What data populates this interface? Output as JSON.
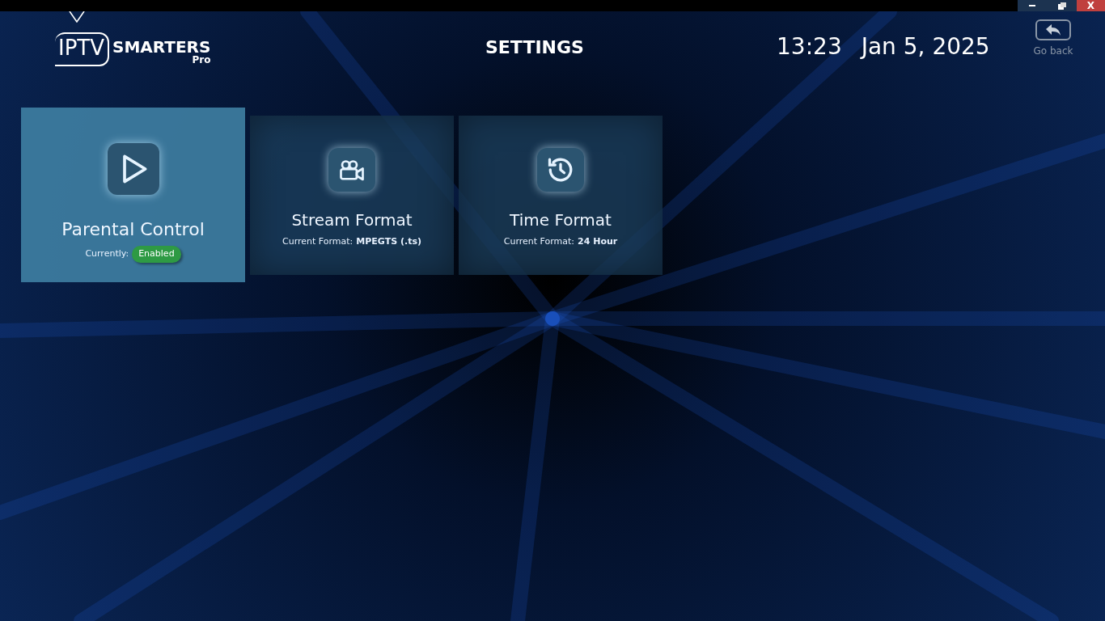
{
  "window_controls": {
    "close": "X"
  },
  "logo": {
    "word_1": "IPTV",
    "word_2": "SMARTERS",
    "subtitle": "Pro"
  },
  "header": {
    "title": "SETTINGS",
    "time": "13:23",
    "date": "Jan 5, 2025",
    "back_label": "Go back"
  },
  "cards": [
    {
      "title": "Parental Control",
      "selected": true,
      "kind": "badge",
      "status_label": "Currently:",
      "status_value": "Enabled"
    },
    {
      "title": "Stream Format",
      "selected": false,
      "kind": "text",
      "status_label": "Current Format:",
      "status_value": "MPEGTS (.ts)"
    },
    {
      "title": "Time Format",
      "selected": false,
      "kind": "text",
      "status_label": "Current Format:",
      "status_value": "24 Hour"
    }
  ]
}
